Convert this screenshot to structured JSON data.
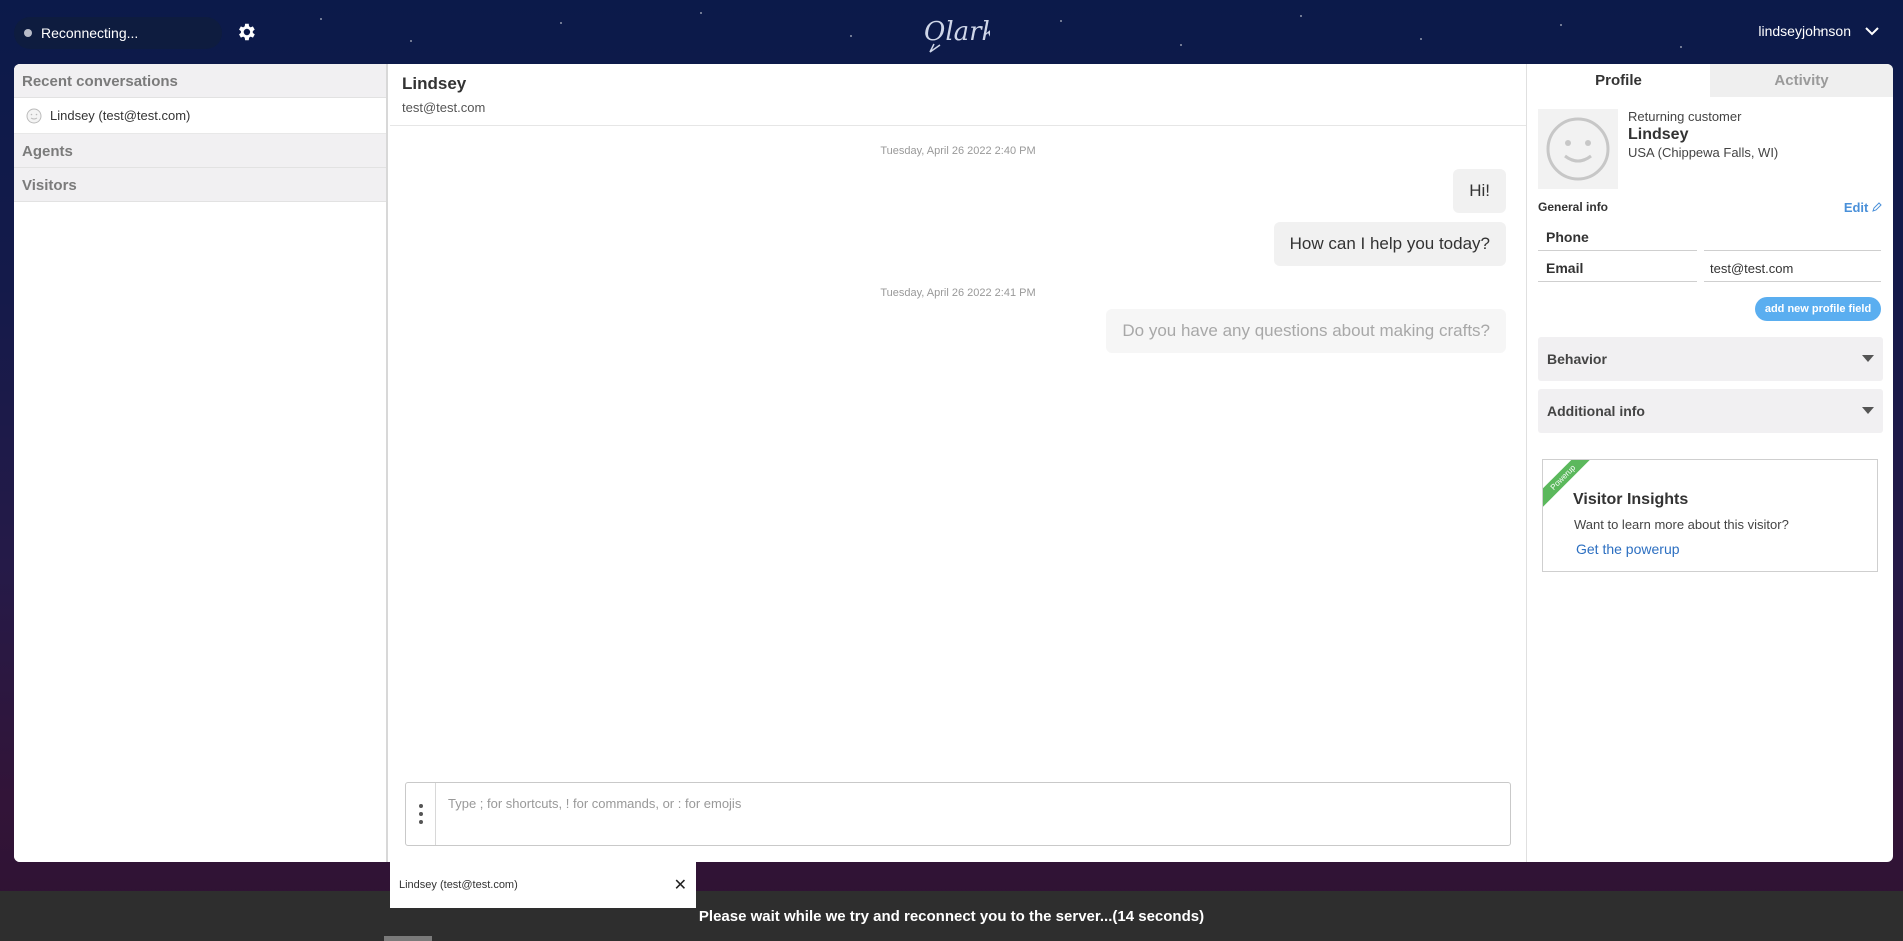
{
  "topbar": {
    "status_text": "Reconnecting...",
    "username": "lindseyjohnson"
  },
  "sidebar": {
    "recent_title": "Recent conversations",
    "recent_items": [
      {
        "label": "Lindsey (test@test.com)"
      }
    ],
    "agents_title": "Agents",
    "visitors_title": "Visitors"
  },
  "conversation": {
    "name": "Lindsey",
    "email": "test@test.com",
    "messages": [
      {
        "date": "Tuesday, April 26 2022 2:40 PM"
      },
      {
        "text": "Hi!"
      },
      {
        "text": "How can I help you today?"
      },
      {
        "date": "Tuesday, April 26 2022 2:41 PM"
      },
      {
        "text": "Do you have any questions about making crafts?"
      }
    ],
    "composer_placeholder": "Type ; for shortcuts, ! for commands, or : for emojis"
  },
  "profile": {
    "tabs": [
      "Profile",
      "Activity"
    ],
    "customer_tag": "Returning customer",
    "name": "Lindsey",
    "location": "USA (Chippewa Falls, WI)",
    "general_info_title": "General info",
    "edit_label": "Edit",
    "fields": [
      {
        "label": "Phone",
        "value": ""
      },
      {
        "label": "Email",
        "value": "test@test.com"
      }
    ],
    "add_field_label": "add new profile field",
    "sections": [
      "Behavior",
      "Additional info"
    ],
    "powerup": {
      "ribbon": "Powerup",
      "title": "Visitor Insights",
      "description": "Want to learn more about this visitor?",
      "link": "Get the powerup"
    }
  },
  "bottom": {
    "open_tab_label": "Lindsey (test@test.com)",
    "close_glyph": "✕",
    "reconnect_message": "Please wait while we try and reconnect you to the server...(14 seconds)"
  },
  "colors": {
    "accent_blue": "#4a90d9",
    "button_blue": "#5aaef0",
    "powerup_green": "#5bb85c",
    "banner_bg": "#2e2e2e"
  }
}
